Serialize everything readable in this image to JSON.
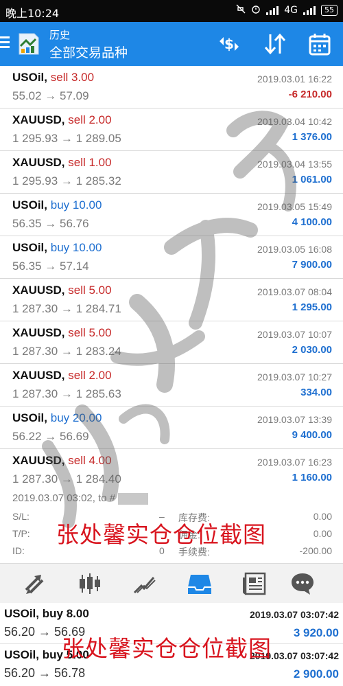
{
  "status_bar": {
    "time": "晚上10:24",
    "network": "4G",
    "battery": "55",
    "icons": [
      "mute-icon",
      "alarm-icon",
      "signal-icon",
      "signal-icon",
      "battery-icon"
    ]
  },
  "app_bar": {
    "subtitle": "历史",
    "title": "全部交易品种",
    "icons": [
      "menu-icon",
      "app-logo-icon",
      "currency-sort-icon",
      "sort-order-icon",
      "calendar-icon"
    ]
  },
  "colors": {
    "accent": "#1e87e6",
    "sell": "#c62828",
    "buy": "#1e6fd0",
    "profit_positive": "#1e6fd0",
    "profit_negative": "#c62828"
  },
  "history": [
    {
      "symbol": "USOil,",
      "side": "sell 3.00",
      "type": "sell",
      "prices": "55.02 → 57.09",
      "time": "2019.03.01 16:22",
      "profit": "-6 210.00"
    },
    {
      "symbol": "XAUUSD,",
      "side": "sell 2.00",
      "type": "sell",
      "prices": "1 295.93 → 1 289.05",
      "time": "2019.03.04 10:42",
      "profit": "1 376.00"
    },
    {
      "symbol": "XAUUSD,",
      "side": "sell 1.00",
      "type": "sell",
      "prices": "1 295.93 → 1 285.32",
      "time": "2019.03.04 13:55",
      "profit": "1 061.00"
    },
    {
      "symbol": "USOil,",
      "side": "buy 10.00",
      "type": "buy",
      "prices": "56.35 → 56.76",
      "time": "2019.03.05 15:49",
      "profit": "4 100.00"
    },
    {
      "symbol": "USOil,",
      "side": "buy 10.00",
      "type": "buy",
      "prices": "56.35 → 57.14",
      "time": "2019.03.05 16:08",
      "profit": "7 900.00"
    },
    {
      "symbol": "XAUUSD,",
      "side": "sell 5.00",
      "type": "sell",
      "prices": "1 287.30 → 1 284.71",
      "time": "2019.03.07 08:04",
      "profit": "1 295.00"
    },
    {
      "symbol": "XAUUSD,",
      "side": "sell 5.00",
      "type": "sell",
      "prices": "1 287.30 → 1 283.24",
      "time": "2019.03.07 10:07",
      "profit": "2 030.00"
    },
    {
      "symbol": "XAUUSD,",
      "side": "sell 2.00",
      "type": "sell",
      "prices": "1 287.30 → 1 285.63",
      "time": "2019.03.07 10:27",
      "profit": "334.00"
    },
    {
      "symbol": "USOil,",
      "side": "buy 20.00",
      "type": "buy",
      "prices": "56.22 → 56.69",
      "time": "2019.03.07 13:39",
      "profit": "9 400.00"
    },
    {
      "symbol": "XAUUSD,",
      "side": "sell 4.00",
      "type": "sell",
      "prices": "1 287.30 → 1 284.40",
      "time": "2019.03.07 16:23",
      "profit": "1 160.00"
    }
  ],
  "details": {
    "line1": "2019.03.07 03:02, to #",
    "sl_label": "S/L:",
    "sl_value": "–",
    "tp_label": "T/P:",
    "id_label": "ID:",
    "id_value": "0",
    "swap_label": "库存费:",
    "swap_value": "0.00",
    "commission_label": "佣金:",
    "commission_value": "0.00",
    "fee_label": "手续费:",
    "fee_value": "-200.00"
  },
  "tabs": [
    {
      "name": "tab-quotes",
      "icon": "arrows-icon",
      "active": false
    },
    {
      "name": "tab-chart",
      "icon": "candlestick-icon",
      "active": false
    },
    {
      "name": "tab-trade",
      "icon": "trend-icon",
      "active": false
    },
    {
      "name": "tab-history",
      "icon": "inbox-icon",
      "active": true
    },
    {
      "name": "tab-news",
      "icon": "newspaper-icon",
      "active": false
    },
    {
      "name": "tab-messages",
      "icon": "chat-icon",
      "active": false
    }
  ],
  "bottom_history": [
    {
      "symbol": "USOil,",
      "side": "buy 8.00",
      "type": "buy",
      "prices": "56.20 → 56.69",
      "time": "2019.03.07 03:07:42",
      "profit": "3 920.00"
    },
    {
      "symbol": "USOil,",
      "side": "buy 5.00",
      "type": "buy",
      "prices": "56.20 → 56.78",
      "time": "2019.03.07 03:07:42",
      "profit": "2 900.00"
    }
  ],
  "watermark": {
    "caption": "张处馨实仓仓位截图",
    "script": "张处馨"
  }
}
